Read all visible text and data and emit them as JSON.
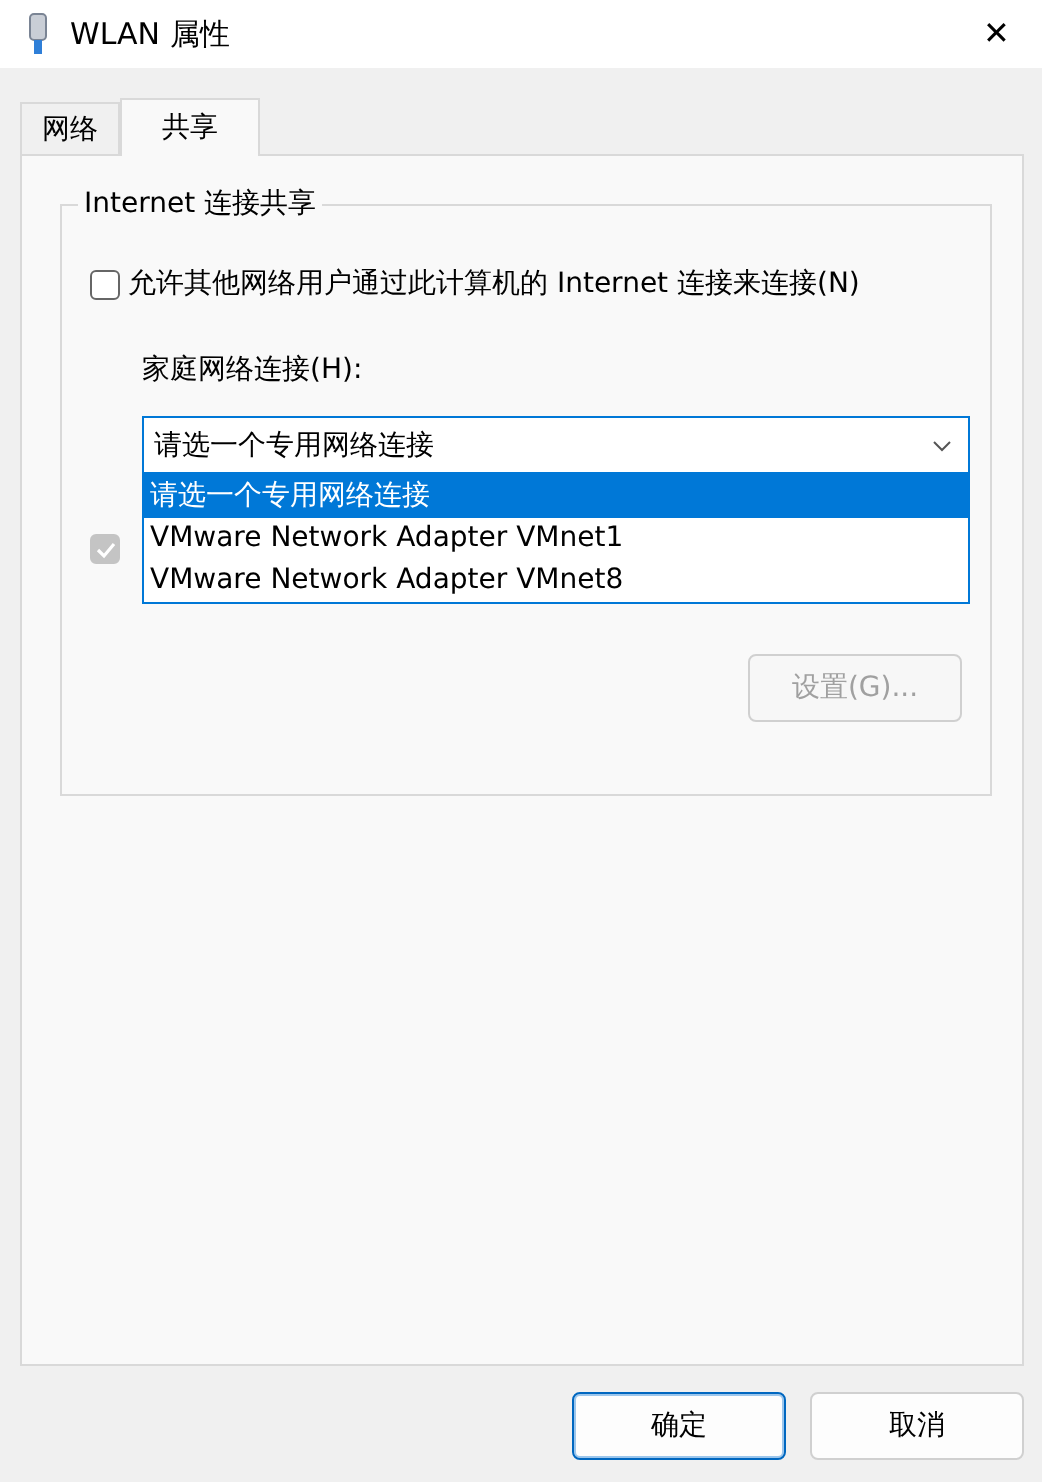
{
  "window": {
    "title": "WLAN 属性",
    "close": "✕"
  },
  "tabs": [
    {
      "label": "网络",
      "selected": false
    },
    {
      "label": "共享",
      "selected": true
    }
  ],
  "group": {
    "title": "Internet 连接共享",
    "allow": {
      "label": "允许其他网络用户通过此计算机的 Internet 连接来连接(N)",
      "checked": false
    },
    "home_label": "家庭网络连接(H):",
    "dropdown": {
      "value": "请选一个专用网络连接",
      "expanded": true,
      "options": [
        {
          "label": "请选一个专用网络连接",
          "selected": true
        },
        {
          "label": "VMware Network Adapter VMnet1",
          "selected": false
        },
        {
          "label": "VMware Network Adapter VMnet8",
          "selected": false
        }
      ]
    },
    "control": {
      "checked": true,
      "disabled": true
    },
    "settings": {
      "label": "设置(G)...",
      "disabled": true
    }
  },
  "buttons": [
    {
      "label": "确定",
      "default": true
    },
    {
      "label": "取消",
      "default": false
    }
  ]
}
